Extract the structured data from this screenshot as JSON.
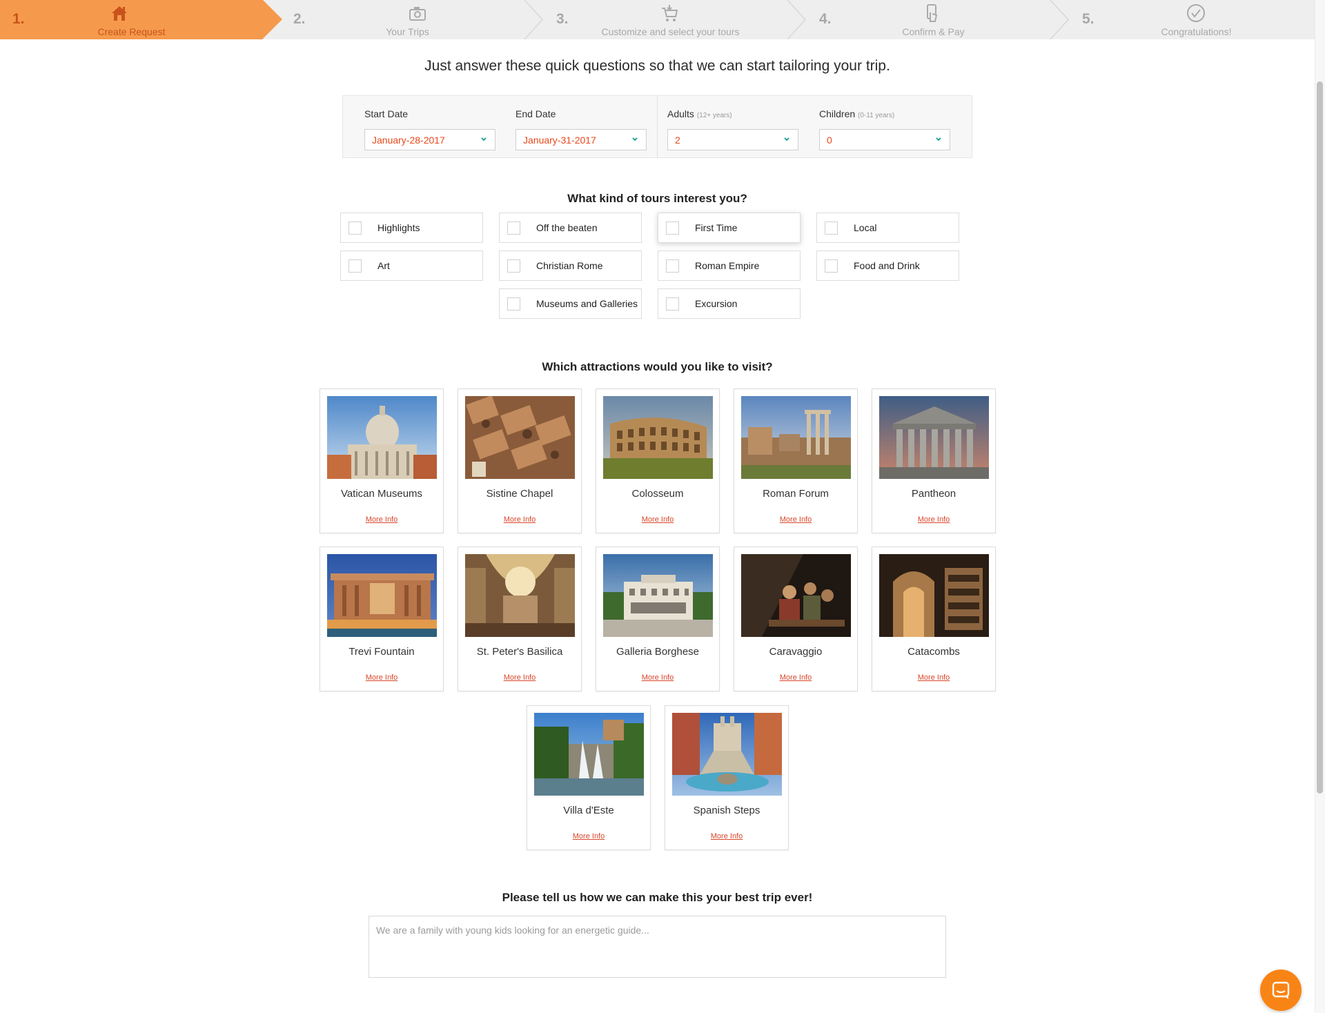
{
  "stepper": {
    "steps": [
      {
        "num": "1.",
        "label": "Create Request",
        "icon": "house-icon",
        "active": true
      },
      {
        "num": "2.",
        "label": "Your Trips",
        "icon": "camera-icon",
        "active": false
      },
      {
        "num": "3.",
        "label": "Customize and select your tours",
        "icon": "cart-icon",
        "active": false
      },
      {
        "num": "4.",
        "label": "Confirm & Pay",
        "icon": "tap-phone-icon",
        "active": false
      },
      {
        "num": "5.",
        "label": "Congratulations!",
        "icon": "check-circle-icon",
        "active": false
      }
    ]
  },
  "intro": "Just answer these quick questions so that we can start tailoring your trip.",
  "form": {
    "start_date": {
      "label": "Start Date",
      "value": "January-28-2017"
    },
    "end_date": {
      "label": "End Date",
      "value": "January-31-2017"
    },
    "adults": {
      "label": "Adults",
      "hint": "(12+ years)",
      "value": "2"
    },
    "children": {
      "label": "Children",
      "hint": "(0-11 years)",
      "value": "0"
    }
  },
  "tours": {
    "title": "What kind of tours interest you?",
    "options": [
      "Highlights",
      "Off the beaten",
      "First Time",
      "Local",
      "Art",
      "Christian Rome",
      "Roman Empire",
      "Food and Drink",
      "Museums and Galleries",
      "Excursion"
    ]
  },
  "attractions": {
    "title": "Which attractions would you like to visit?",
    "more_label": "More Info",
    "items": [
      "Vatican Museums",
      "Sistine Chapel",
      "Colosseum",
      "Roman Forum",
      "Pantheon",
      "Trevi Fountain",
      "St. Peter's Basilica",
      "Galleria Borghese",
      "Caravaggio",
      "Catacombs",
      "Villa d'Este",
      "Spanish Steps"
    ]
  },
  "notes": {
    "title": "Please tell us how we can make this your best trip ever!",
    "placeholder": "We are a family with young kids looking for an energetic guide..."
  },
  "colors": {
    "accent": "#f59a4c",
    "accent_text": "#c9521b",
    "value_text": "#e8481c",
    "link": "#d9462a",
    "chat": "#f98416"
  }
}
